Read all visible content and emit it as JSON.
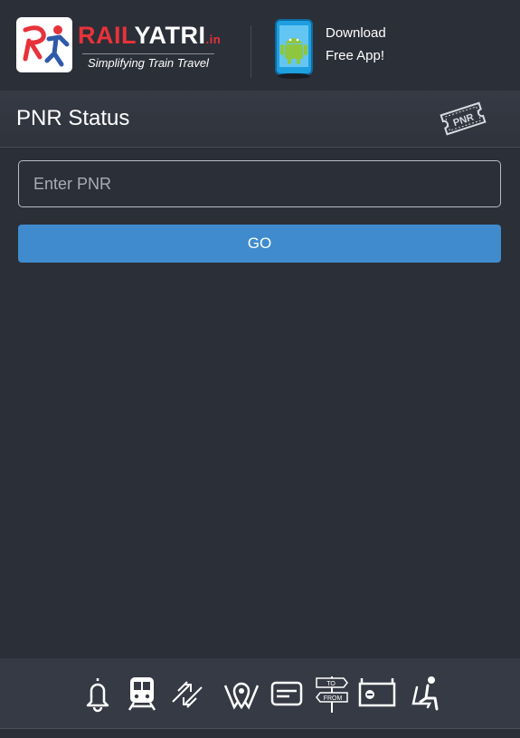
{
  "header": {
    "logo": {
      "rail": "RAIL",
      "yatri": "YATRI",
      "suffix": ".in",
      "tagline": "Simplifying Train Travel"
    },
    "download": {
      "line1": "Download",
      "line2": "Free App!"
    }
  },
  "pnr": {
    "title": "PNR Status",
    "ticket_icon_label": "PNR",
    "input_placeholder": "Enter PNR",
    "input_value": "",
    "go_label": "GO"
  },
  "footer_nav": {
    "items": [
      {
        "icon": "bell-icon"
      },
      {
        "icon": "train-icon"
      },
      {
        "icon": "swap-arrows-icon"
      },
      {
        "icon": "location-pin-icon"
      },
      {
        "icon": "card-icon"
      },
      {
        "icon": "to-from-signpost-icon",
        "sign_to": "TO",
        "sign_from": "FROM"
      },
      {
        "icon": "platform-sign-icon"
      },
      {
        "icon": "seat-icon"
      }
    ]
  },
  "colors": {
    "background": "#2b2f38",
    "bar": "#363a44",
    "accent_button": "#3f8bce",
    "brand_red": "#e8323a"
  }
}
